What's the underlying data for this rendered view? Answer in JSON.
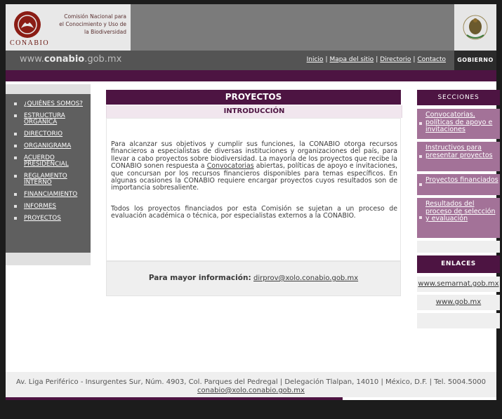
{
  "header": {
    "logo_text": [
      "Comisión Nacional para",
      "el Conocimiento y Uso de",
      "la Biodiversidad"
    ],
    "logo_word": "CONABIO",
    "url_plain_prefix": "www.",
    "url_bold": "conabio",
    "url_suffix": ".gob.mx",
    "top_links": [
      "Inicio",
      "Mapa del sitio",
      "Directorio",
      "Contacto"
    ],
    "gobierno": "GOBIERNO"
  },
  "left_nav": {
    "items": [
      "¿QUIÉNES SOMOS?",
      "ESTRUCTURA ORGÁNICA",
      "DIRECTORIO",
      "ORGANIGRAMA",
      "ACUERDO PRESIDENCIAL",
      "REGLAMENTO INTERNO",
      "FINANCIAMIENTO",
      "INFORMES",
      "PROYECTOS"
    ]
  },
  "main": {
    "title": "PROYECTOS",
    "subtitle": "INTRODUCCIÓN",
    "p1_before_link": "Para alcanzar sus objetivos y cumplir sus funciones, la CONABIO otorga recursos financieros a especialistas de diversas instituciones y organizaciones del país, para llevar a cabo proyectos sobre biodiversidad. La mayoría de los proyectos que recibe la CONABIO sonen respuesta a ",
    "p1_link": "Convocatorias",
    "p1_after_link": " abiertas, políticas de apoyo e invitaciones, que concursan por los recursos financieros disponibles para temas específicos. En algunas ocasiones la CONABIO requiere encargar proyectos cuyos resultados son de importancia sobresaliente.",
    "p2": "Todos los proyectos financiados por esta Comisión se sujetan a un proceso de evaluación académica o técnica, por especialistas externos a la CONABIO.",
    "info_label": "Para mayor información:",
    "info_email": "dirprov@xolo.conabio.gob.mx"
  },
  "right": {
    "sections_header": "SECCIONES",
    "sections": [
      "Convocatorias, políticas de apoyo e invitaciones",
      "Instructivos para presentar proyectos",
      "Proyectos financiados",
      "Resultados del proceso de selección y evaluación"
    ],
    "links_header": "ENLACES",
    "links": [
      "www.semarnat.gob.mx",
      "www.gob.mx"
    ]
  },
  "footer": {
    "address": "Av. Liga Periférico - Insurgentes Sur, Núm. 4903, Col. Parques del Pedregal | Delegación Tlalpan, 14010 | México, D.F. | Tel. 5004.5000",
    "email": "conabio@xolo.conabio.gob.mx"
  },
  "colors": {
    "purple": "#4d1442",
    "mauve": "#a37298",
    "dark_gray": "#545454",
    "mid_gray": "#5f5f5f"
  }
}
